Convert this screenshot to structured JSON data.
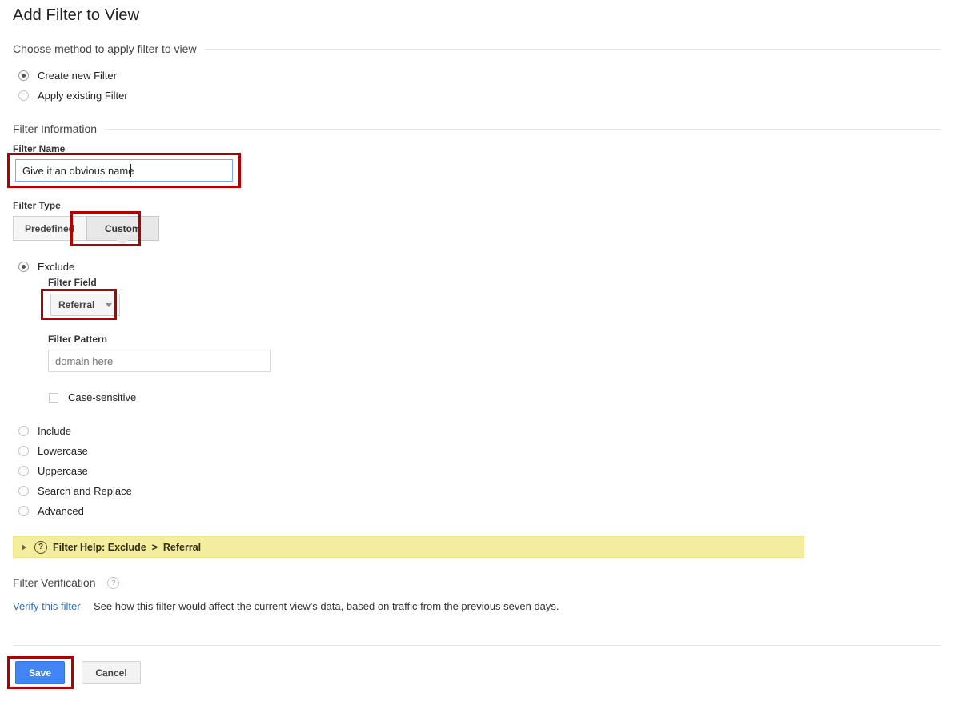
{
  "page": {
    "title": "Add Filter to View"
  },
  "method_section": {
    "heading": "Choose method to apply filter to view",
    "options": [
      {
        "label": "Create new Filter",
        "selected": true
      },
      {
        "label": "Apply existing Filter",
        "selected": false
      }
    ]
  },
  "filter_information": {
    "heading": "Filter Information",
    "filter_name": {
      "label": "Filter Name",
      "value": "Give it an obvious name",
      "placeholder": ""
    },
    "filter_type": {
      "label": "Filter Type",
      "tabs": [
        {
          "label": "Predefined",
          "selected": false
        },
        {
          "label": "Custom",
          "selected": true
        }
      ]
    }
  },
  "custom_filter": {
    "exclude": {
      "label": "Exclude",
      "selected": true,
      "filter_field": {
        "label": "Filter Field",
        "value": "Referral",
        "caret_icon": "chevron-down-icon"
      },
      "filter_pattern": {
        "label": "Filter Pattern",
        "value": "",
        "placeholder": "domain here"
      },
      "case_sensitive": {
        "label": "Case-sensitive",
        "checked": false
      }
    },
    "other_options": [
      {
        "label": "Include",
        "selected": false
      },
      {
        "label": "Lowercase",
        "selected": false
      },
      {
        "label": "Uppercase",
        "selected": false
      },
      {
        "label": "Search and Replace",
        "selected": false
      },
      {
        "label": "Advanced",
        "selected": false
      }
    ]
  },
  "filter_help": {
    "expander_icon": "triangle-right-icon",
    "question_icon": "question-mark-icon",
    "question_glyph": "?",
    "text": "Filter Help: Exclude  >  Referral"
  },
  "filter_verification": {
    "heading": "Filter Verification",
    "help_icon": "question-mark-icon",
    "help_glyph": "?",
    "link_label": "Verify this filter",
    "description": "See how this filter would affect the current view's data, based on traffic from the previous seven days."
  },
  "actions": {
    "save_label": "Save",
    "cancel_label": "Cancel"
  },
  "colors": {
    "primary_button": "#4285f4",
    "link": "#2a6dc0",
    "annotation": "#b00000",
    "help_bar": "#f5ed9e",
    "focus_border": "#7eaaf0"
  }
}
